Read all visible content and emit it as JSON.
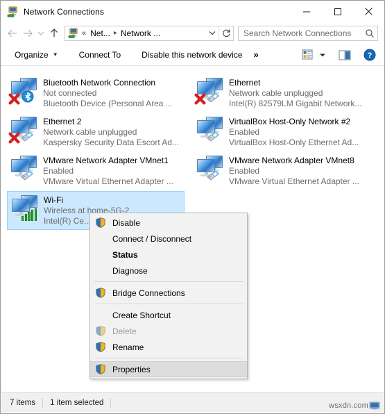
{
  "window": {
    "title": "Network Connections",
    "title_icon": "network-connections-icon",
    "minimize_label": "Minimize",
    "maximize_label": "Maximize",
    "close_label": "Close"
  },
  "navbar": {
    "back_icon": "back-arrow-icon",
    "forward_icon": "forward-arrow-icon",
    "recent_icon": "recent-locations-chevron-icon",
    "up_icon": "up-arrow-icon",
    "address_icon": "network-connections-icon",
    "breadcrumb_overflow": "«",
    "crumbs": [
      "Net...",
      "Network ..."
    ],
    "dropdown_icon": "chevron-down-icon",
    "refresh_icon": "refresh-icon"
  },
  "search": {
    "placeholder": "Search Network Connections",
    "value": "",
    "icon": "search-icon"
  },
  "toolbar": {
    "organize_label": "Organize",
    "organize_caret": "▼",
    "connect_to_label": "Connect To",
    "disable_device_label": "Disable this network device",
    "overflow_label": "»",
    "view_icon": "view-layout-icon",
    "view_caret": "▼",
    "preview_pane_icon": "preview-pane-icon",
    "help_icon": "help-icon"
  },
  "connections": [
    {
      "name": "Bluetooth Network Connection",
      "status": "Not connected",
      "device": "Bluetooth Device (Personal Area ...",
      "icon": "network-adapter-icon",
      "overlay": "red-x-icon",
      "badge": "bluetooth-icon",
      "selected": false
    },
    {
      "name": "Ethernet",
      "status": "Network cable unplugged",
      "device": "Intel(R) 82579LM Gigabit Network...",
      "icon": "network-adapter-icon",
      "overlay": "red-x-icon",
      "badge": "rj45-plug-icon",
      "selected": false
    },
    {
      "name": "Ethernet 2",
      "status": "Network cable unplugged",
      "device": "Kaspersky Security Data Escort Ad...",
      "icon": "network-adapter-icon",
      "overlay": "red-x-icon",
      "badge": "rj45-plug-icon",
      "selected": false
    },
    {
      "name": "VirtualBox Host-Only Network #2",
      "status": "Enabled",
      "device": "VirtualBox Host-Only Ethernet Ad...",
      "icon": "network-adapter-icon",
      "overlay": "",
      "badge": "rj45-plug-icon",
      "selected": false
    },
    {
      "name": "VMware Network Adapter VMnet1",
      "status": "Enabled",
      "device": "VMware Virtual Ethernet Adapter ...",
      "icon": "network-adapter-icon",
      "overlay": "",
      "badge": "rj45-plug-icon",
      "selected": false
    },
    {
      "name": "VMware Network Adapter VMnet8",
      "status": "Enabled",
      "device": "VMware Virtual Ethernet Adapter ...",
      "icon": "network-adapter-icon",
      "overlay": "",
      "badge": "rj45-plug-icon",
      "selected": false
    },
    {
      "name": "Wi-Fi",
      "status": "Wireless at home-5G-2",
      "device": "Intel(R) Ce...",
      "icon": "network-adapter-icon",
      "overlay": "",
      "badge": "wifi-signal-bars-icon",
      "selected": true
    }
  ],
  "context_menu": {
    "items": [
      {
        "label": "Disable",
        "shield": true,
        "bold": false,
        "disabled": false,
        "hover": false,
        "sep_after": false
      },
      {
        "label": "Connect / Disconnect",
        "shield": false,
        "bold": false,
        "disabled": false,
        "hover": false,
        "sep_after": false
      },
      {
        "label": "Status",
        "shield": false,
        "bold": true,
        "disabled": false,
        "hover": false,
        "sep_after": false
      },
      {
        "label": "Diagnose",
        "shield": false,
        "bold": false,
        "disabled": false,
        "hover": false,
        "sep_after": true
      },
      {
        "label": "Bridge Connections",
        "shield": true,
        "bold": false,
        "disabled": false,
        "hover": false,
        "sep_after": true
      },
      {
        "label": "Create Shortcut",
        "shield": false,
        "bold": false,
        "disabled": false,
        "hover": false,
        "sep_after": false
      },
      {
        "label": "Delete",
        "shield": true,
        "bold": false,
        "disabled": true,
        "hover": false,
        "sep_after": false
      },
      {
        "label": "Rename",
        "shield": true,
        "bold": false,
        "disabled": false,
        "hover": false,
        "sep_after": true
      },
      {
        "label": "Properties",
        "shield": true,
        "bold": false,
        "disabled": false,
        "hover": true,
        "sep_after": false
      }
    ]
  },
  "statusbar": {
    "item_count": "7 items",
    "selection": "1 item selected"
  },
  "watermark": {
    "text": "wsxdn.com",
    "icon": "monitor-icon"
  },
  "colors": {
    "selection_fill": "#cce8ff",
    "selection_border": "#99d1ff",
    "menu_bg": "#f2f2f2",
    "menu_hover": "#dcdcdc",
    "secondary_text": "#6d6d6d",
    "accent_blue": "#2b74c4",
    "signal_green": "#2faa2f",
    "error_red": "#d32020"
  }
}
